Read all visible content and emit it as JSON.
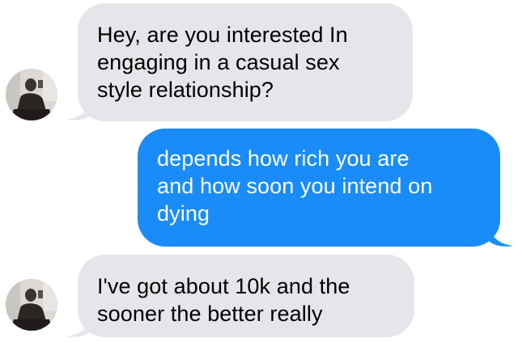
{
  "conversation": {
    "messages": [
      {
        "direction": "incoming",
        "text": "Hey, are you interested In\nengaging in a casual sex\nstyle relationship?"
      },
      {
        "direction": "outgoing",
        "text": "depends how rich you are\nand how soon you intend on\ndying"
      },
      {
        "direction": "incoming",
        "text": "I've got about 10k and the\nsooner the better really"
      }
    ]
  },
  "colors": {
    "incoming_bubble": "#e5e5ea",
    "outgoing_bubble": "#1a8cf7",
    "outgoing_text": "#ffffff",
    "incoming_text": "#000000"
  },
  "icons": {
    "avatar": "contact-avatar-photo"
  }
}
